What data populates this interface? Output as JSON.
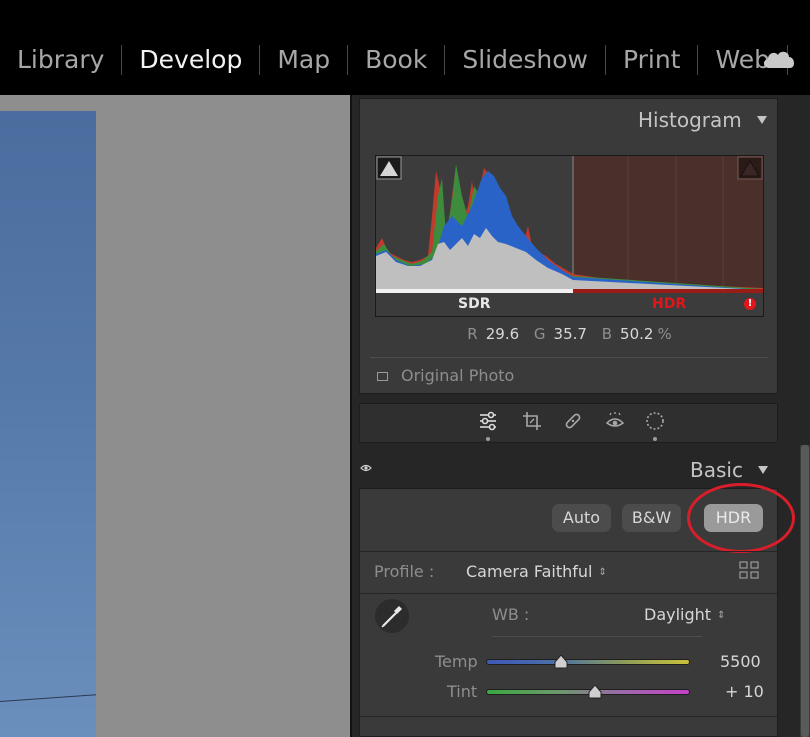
{
  "modules": [
    "Library",
    "Develop",
    "Map",
    "Book",
    "Slideshow",
    "Print",
    "Web"
  ],
  "active_module": "Develop",
  "histogram": {
    "title": "Histogram",
    "sdr_label": "SDR",
    "hdr_label": "HDR",
    "r_label": "R",
    "r_value": "29.6",
    "g_label": "G",
    "g_value": "35.7",
    "b_label": "B",
    "b_value": "50.2",
    "unit": "%",
    "original_photo": "Original Photo"
  },
  "basic": {
    "title": "Basic",
    "auto": "Auto",
    "bw": "B&W",
    "hdr": "HDR",
    "profile_label": "Profile :",
    "profile_value": "Camera Faithful",
    "wb_label": "WB :",
    "wb_value": "Daylight",
    "temp_label": "Temp",
    "temp_value": "5500",
    "tint_label": "Tint",
    "tint_value": "+ 10"
  },
  "colors": {
    "hdr_red": "#e0161b",
    "annotation_red": "#d81e2a"
  },
  "icons": [
    "cloud-icon",
    "basic-adjust-icon",
    "crop-icon",
    "heal-icon",
    "redeye-icon",
    "masking-icon",
    "eye-icon",
    "grid-icon",
    "eyedropper-icon"
  ]
}
